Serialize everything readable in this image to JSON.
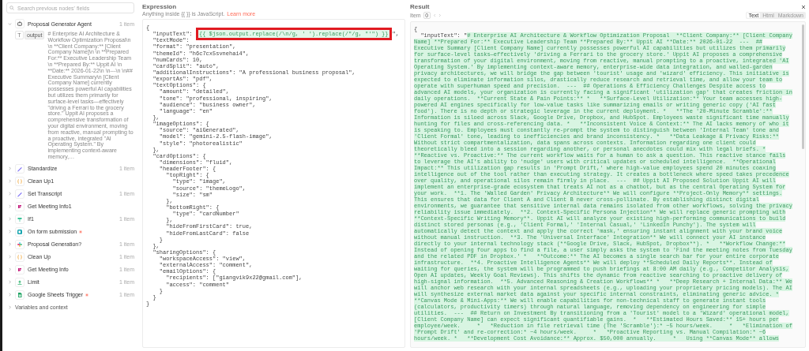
{
  "sidebar": {
    "search": {
      "placeholder": "Search previous nodes' fields"
    },
    "nodes": [
      {
        "name": "Proposal Generator Agent",
        "kind": "agent",
        "count": "1 item",
        "expanded": true,
        "pinned": false,
        "fields": [
          {
            "type": "T",
            "label": "output",
            "value": "# Enterprise AI Architecture & Workflow Optimization Proposal\\n \\n **Client Company:** [Client Company Name]\\n \\n **Prepared For:** Executive Leadership Team \\n **Prepared By:** Uppit AI \\n **Date:** 2026-01-22\\n \\n---\\n \\n## Executive Summary\\n [Client Company Name] currently possesses powerful AI capabilities but utilizes them primarily for surface-level tasks—effectively \"driving a Ferrari to the grocery store.\" Uppit AI proposes a comprehensive transformation of your digital environment, moving from reactive, manual prompting to a proactive, integrated \"AI Operating System.\" By implementing context-aware memory,…"
          }
        ]
      },
      {
        "name": "Standardize",
        "kind": "edit",
        "count": "1 item",
        "expanded": false,
        "pinned": false
      },
      {
        "name": "Clean Up1",
        "kind": "code",
        "expanded": false,
        "pinned": false
      },
      {
        "name": "Set Transcript",
        "kind": "edit",
        "count": "1 item",
        "expanded": false,
        "pinned": false
      },
      {
        "name": "Get Meeting Info1",
        "kind": "app",
        "expanded": false,
        "pinned": false
      },
      {
        "name": "If1",
        "kind": "if",
        "count": "1 item",
        "expanded": false,
        "pinned": false
      },
      {
        "name": "On form submission",
        "kind": "form",
        "expanded": false,
        "pinned": true
      },
      {
        "name": "Proposal Generation?",
        "kind": "slack",
        "count": "1 item",
        "expanded": false,
        "pinned": false
      },
      {
        "name": "Clean Up",
        "kind": "code",
        "count": "1 item",
        "expanded": false,
        "pinned": false
      },
      {
        "name": "Get Meeting Info",
        "kind": "app",
        "count": "1 item",
        "expanded": false,
        "pinned": false
      },
      {
        "name": "Limit",
        "kind": "limit",
        "count": "1 item",
        "expanded": false,
        "pinned": false
      },
      {
        "name": "Google Sheets Trigger",
        "kind": "sheets",
        "count": "1 item",
        "expanded": false,
        "pinned": true
      }
    ],
    "variables": {
      "label": "Variables and context",
      "expanded": false
    }
  },
  "expression": {
    "title": "Expression",
    "hint": "Anything inside {{ }} is JavaScript.",
    "link": "Learn more",
    "lines": [
      {
        "kind": "plain",
        "text": "{"
      },
      {
        "kind": "expression",
        "key": "  \"inputText\": ",
        "expr": "{{ $json.output.replace(/\\n/g, ' ').replace(/\"/g, \"'\") }}",
        "after": "\",",
        "boxed": true
      },
      {
        "kind": "plain",
        "text": "  \"textMode\":"
      },
      {
        "kind": "plain",
        "text": "  \"format\": \"presentation\","
      },
      {
        "kind": "plain",
        "text": "  \"themeId\": \"h6c7cx5svnehai4\","
      },
      {
        "kind": "plain",
        "text": "  \"numCards\": 10,"
      },
      {
        "kind": "plain",
        "text": "  \"cardSplit\": \"auto\","
      },
      {
        "kind": "plain",
        "text": "  \"additionalInstructions\": \"A professional business proposal\","
      },
      {
        "kind": "plain",
        "text": "  \"exportAs\": \"pdf\","
      },
      {
        "kind": "plain",
        "text": "  \"textOptions\": {"
      },
      {
        "kind": "plain",
        "text": "    \"amount\": \"detailed\","
      },
      {
        "kind": "plain",
        "text": "    \"tone\": \"professional, inspiring\","
      },
      {
        "kind": "plain",
        "text": "    \"audience\": \"business owner\","
      },
      {
        "kind": "plain",
        "text": "    \"language\": \"en\""
      },
      {
        "kind": "plain",
        "text": "  },"
      },
      {
        "kind": "plain",
        "text": "  \"imageOptions\": {"
      },
      {
        "kind": "plain",
        "text": "    \"source\": \"aiGenerated\","
      },
      {
        "kind": "plain",
        "text": "    \"model\": \"gemini-2.5-flash-image\","
      },
      {
        "kind": "plain",
        "text": "    \"style\": \"photorealistic\""
      },
      {
        "kind": "plain",
        "text": "  },"
      },
      {
        "kind": "plain",
        "text": "  \"cardOptions\": {"
      },
      {
        "kind": "plain",
        "text": "    \"dimensions\": \"fluid\","
      },
      {
        "kind": "plain",
        "text": "    \"headerFooter\": {"
      },
      {
        "kind": "plain",
        "text": "      \"topRight\": {"
      },
      {
        "kind": "plain",
        "text": "        \"type\": \"image\","
      },
      {
        "kind": "plain",
        "text": "        \"source\": \"themeLogo\","
      },
      {
        "kind": "plain",
        "text": "        \"size\": \"sm\""
      },
      {
        "kind": "plain",
        "text": "      },"
      },
      {
        "kind": "plain",
        "text": "      \"bottomRight\": {"
      },
      {
        "kind": "plain",
        "text": "        \"type\": \"cardNumber\""
      },
      {
        "kind": "plain",
        "text": "      },"
      },
      {
        "kind": "plain",
        "text": "      \"hideFromFirstCard\": true,"
      },
      {
        "kind": "plain",
        "text": "      \"hideFromLastCard\": false"
      },
      {
        "kind": "plain",
        "text": "    }"
      },
      {
        "kind": "plain",
        "text": "  },"
      },
      {
        "kind": "plain",
        "text": "  \"sharingOptions\": {"
      },
      {
        "kind": "plain",
        "text": "    \"workspaceAccess\": \"view\","
      },
      {
        "kind": "plain",
        "text": "    \"externalAccess\": \"comment\","
      },
      {
        "kind": "plain",
        "text": "    \"emailOptions\": {"
      },
      {
        "kind": "plain",
        "text": "      \"recipients\": [\"giangvik9x22@gmail.com\"],"
      },
      {
        "kind": "plain",
        "text": "      \"access\": \"comment\""
      },
      {
        "kind": "plain",
        "text": "    }"
      },
      {
        "kind": "plain",
        "text": "  }"
      },
      {
        "kind": "plain",
        "text": "}"
      }
    ]
  },
  "result": {
    "title": "Result",
    "item_label": "Item",
    "item_value": "0",
    "formats": [
      {
        "label": "Text",
        "selected": true
      },
      {
        "label": "Html",
        "selected": false
      },
      {
        "label": "Markdown",
        "selected": false
      }
    ],
    "open": "{",
    "key": "  \"inputText\": \"",
    "lines": [
      "# Enterprise AI Architecture & Workflow Optimization Proposal  **Client Company:** [Client Company",
      "Name] **Prepared For:** Executive Leadership Team **Prepared By:** Uppit AI **Date:** 2026-01-22  ---  ##",
      "Executive Summary [Client Company Name] currently possesses powerful AI capabilities but utilizes them primarily",
      "for surface-level tasks—effectively 'driving a Ferrari to the grocery store.' Uppit AI proposes a comprehensive",
      "transformation of your digital environment, moving from reactive, manual prompting to a proactive, integrated 'AI",
      "Operating System.' By implementing context-aware memory, enterprise-wide data integration, and walled-garden",
      "privacy architectures, we will bridge the gap between 'tourist' usage and 'wizard' efficiency. This initiative is",
      "expected to eliminate information silos, drastically reduce research and retrieval time, and allow your team to",
      "operate with superhuman speed and precision.  ---  ## Operations & Efficiency Challenges Despite access to",
      "advanced AI models, your organization is currently facing a significant 'utilization gap' that creates friction in",
      "daily operations.  **Current State & Pain Points:** *   **Surface-Level Utilization:** Your team accesses high-",
      "powered AI engines specifically for low-value tasks like summarizing emails or writing generic copy ('AI fast",
      "food'). There is no depth or strategic leverage in the current deployment. *   **The '20-Minute Scramble':**",
      "Information is siloed across Slack, Google Drive, Dropbox, and HubSpot. Employees waste significant time manually",
      "hunting for files and cross-referencing data. *   **Inconsistent Voice & Context:** The AI lacks memory of who it",
      "is speaking to. Employees must constantly re-prompt the system to distinguish between 'Internal Team' tone and",
      "'Client Formal' tone, leading to inefficiencies and brand inconsistency. *   **Data Leakage & Privacy Risks:**",
      "Without strict compartmentalization, data spans across contexts. Information regarding one client could",
      "theoretically bleed into a session regarding another, or personal anecdotes could mix with legal briefs. *",
      "**Reactive vs. Proactive:** The current workflow waits for a human to ask a question. This reactive stance fails",
      "to leverage the AI's ability to 'nudge' users with critical updates or scheduled intelligence.  **Operational",
      "Impact:** This utilization gap results in 'Prompt Drift,' where high-value employees spend 20 minutes coaxing",
      "intelligence out of the tool rather than executing strategy. It creates a bottleneck where speed takes precedence",
      "over quality, and operational silos remain firmly in place.  ---  ## Uppit AI Proposed Solution Uppit AI will",
      "implement an enterprise-grade ecosystem that treats AI not as a chatbot, but as the central Operating System for",
      "your work.  **1. The 'Walled Garden' Privacy Architecture** We will configure **Project-Only Memory** settings.",
      "This ensures that data for Client A and Client B never cross-pollinate. By establishing distinct digital",
      "environments, we guarantee that sensitive internal data remains isolated from other workflows, solving the privacy",
      "reliability issue immediately.  **2. Context-Specific Persona Injection** We will replace generic prompting with",
      "**Context-Specific Writing Memory**. Uppit AI will analyze your existing high-performing communications to build",
      "distinct stored personas (e.g., 'Client Formal,' 'Internal Casual,' 'LinkedIn Punchy'). The system will",
      "automatically detect the context and apply the correct 'mask,' ensuring instant alignment with your brand voice",
      "without manual instruction.  **3. The 'Universal Interface' Integration** We will connect your AI instance",
      "directly to your internal technology stack (**Google Drive, Slack, HubSpot, Dropbox**). *   **Workflow Change:**",
      "Instead of opening four apps to find a file, a user simply asks the system to 'Find the meeting notes from Tuesday",
      "and the related PDF in Dropbox.' *   **Outcome:** The AI becomes a single search bar for your entire corporate",
      "infrastructure.  **4. Proactive Intelligence Agents** We will deploy **Scheduled Daily Reports**. Instead of",
      "waiting for queries, the system will be programmed to push briefings at 8:00 AM daily (e.g., Competitor Analysis,",
      "Open AI updates, Weekly Goal Reviews). This shifts the dynamic from reactive searching to proactive delivery of",
      "high-signal information.  **5. Advanced Reasoning & Creation Workflows** *   **Deep Research + Internal Data:** We",
      "will anchor web research with your internal spreadsheets (e.g., uploading your proprietary pricing models). The AI",
      "will synthesize external market data against your specific internal constraints, eliminating generic advice. *",
      "**Canvas Mode & Mini-Apps:** We will enable capabilities for non-technical staff to generate instant tools",
      "(calculators, productivity timers) through natural language, removing dependency on engineering for simple",
      "utilities.  ---  ## Return on Investment By transitioning from a 'Tourist' model to a 'Wizard' operational model,",
      "[Client Company Name] can expect significant quantifiable gains.  *   **Estimated Hours Saved:** 15+ hours per",
      "employee/week.     *   *Reduction in file retrieval time (The 'Scramble'):* ~5 hours/week.     *   *Elimination of",
      "'Prompt Drift' and re-correction:* ~4 hours/week.     *   *Proactive Reporting vs. Manual Compilation:* ~6",
      "hours/week. *   **Development Cost Avoidance:** Approx. $50,000 annually.     *   Using **Canvas Mode** allows"
    ]
  }
}
